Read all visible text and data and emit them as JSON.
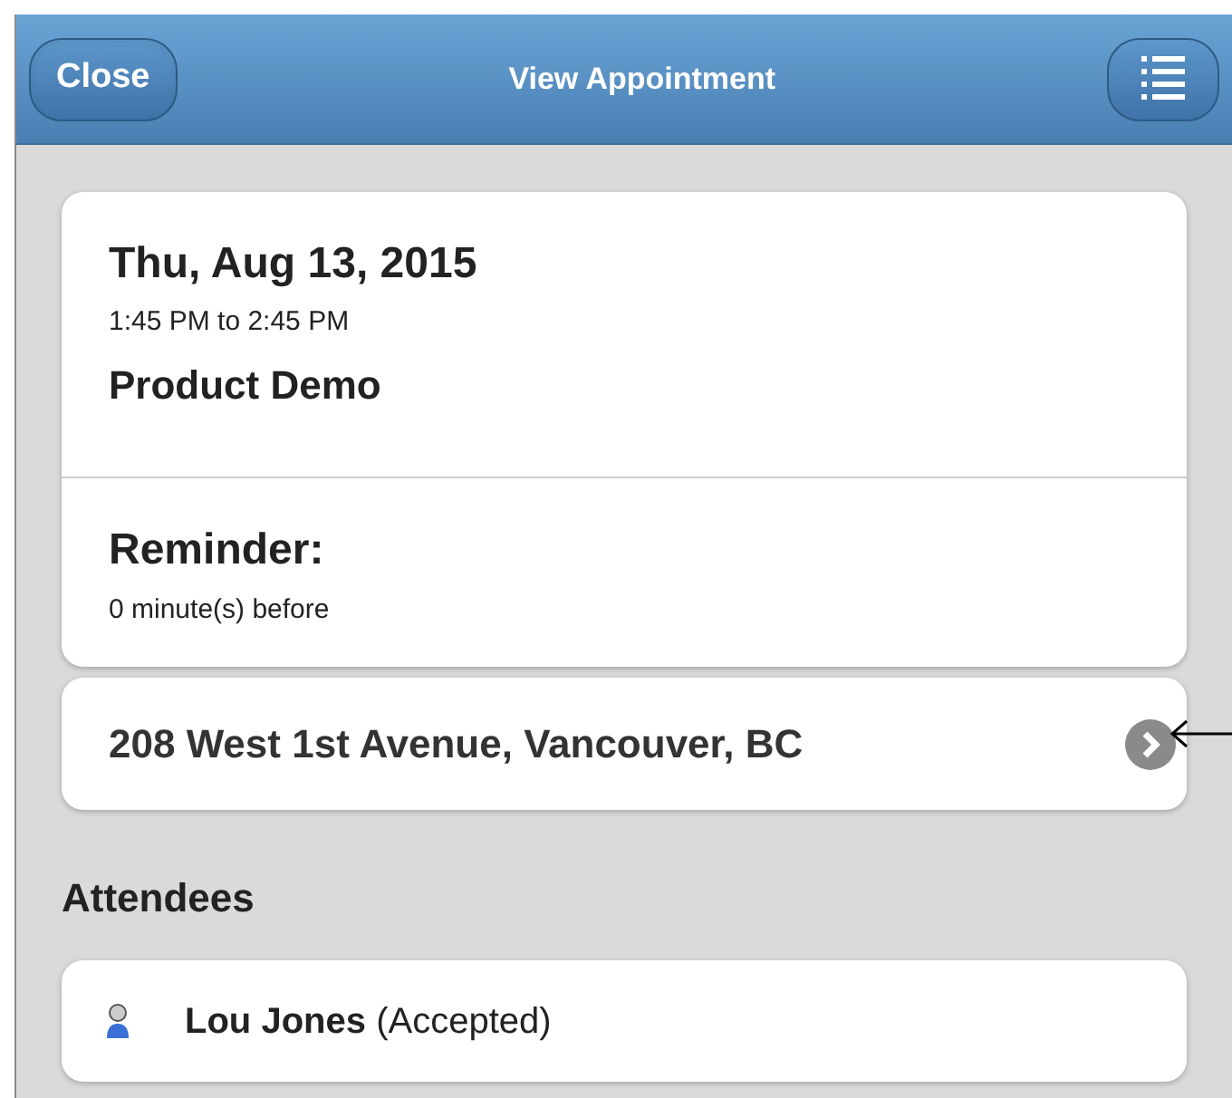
{
  "header": {
    "close_button": "Close",
    "title": "View Appointment"
  },
  "appointment": {
    "date": "Thu, Aug 13, 2015",
    "time": "1:45 PM to 2:45 PM",
    "subject": "Product Demo"
  },
  "reminder": {
    "label": "Reminder:",
    "value": "0 minute(s) before"
  },
  "location": {
    "address": "208 West 1st Avenue, Vancouver, BC"
  },
  "attendees": {
    "heading": "Attendees",
    "items": [
      {
        "name": "Lou Jones",
        "status": "(Accepted)"
      }
    ]
  }
}
